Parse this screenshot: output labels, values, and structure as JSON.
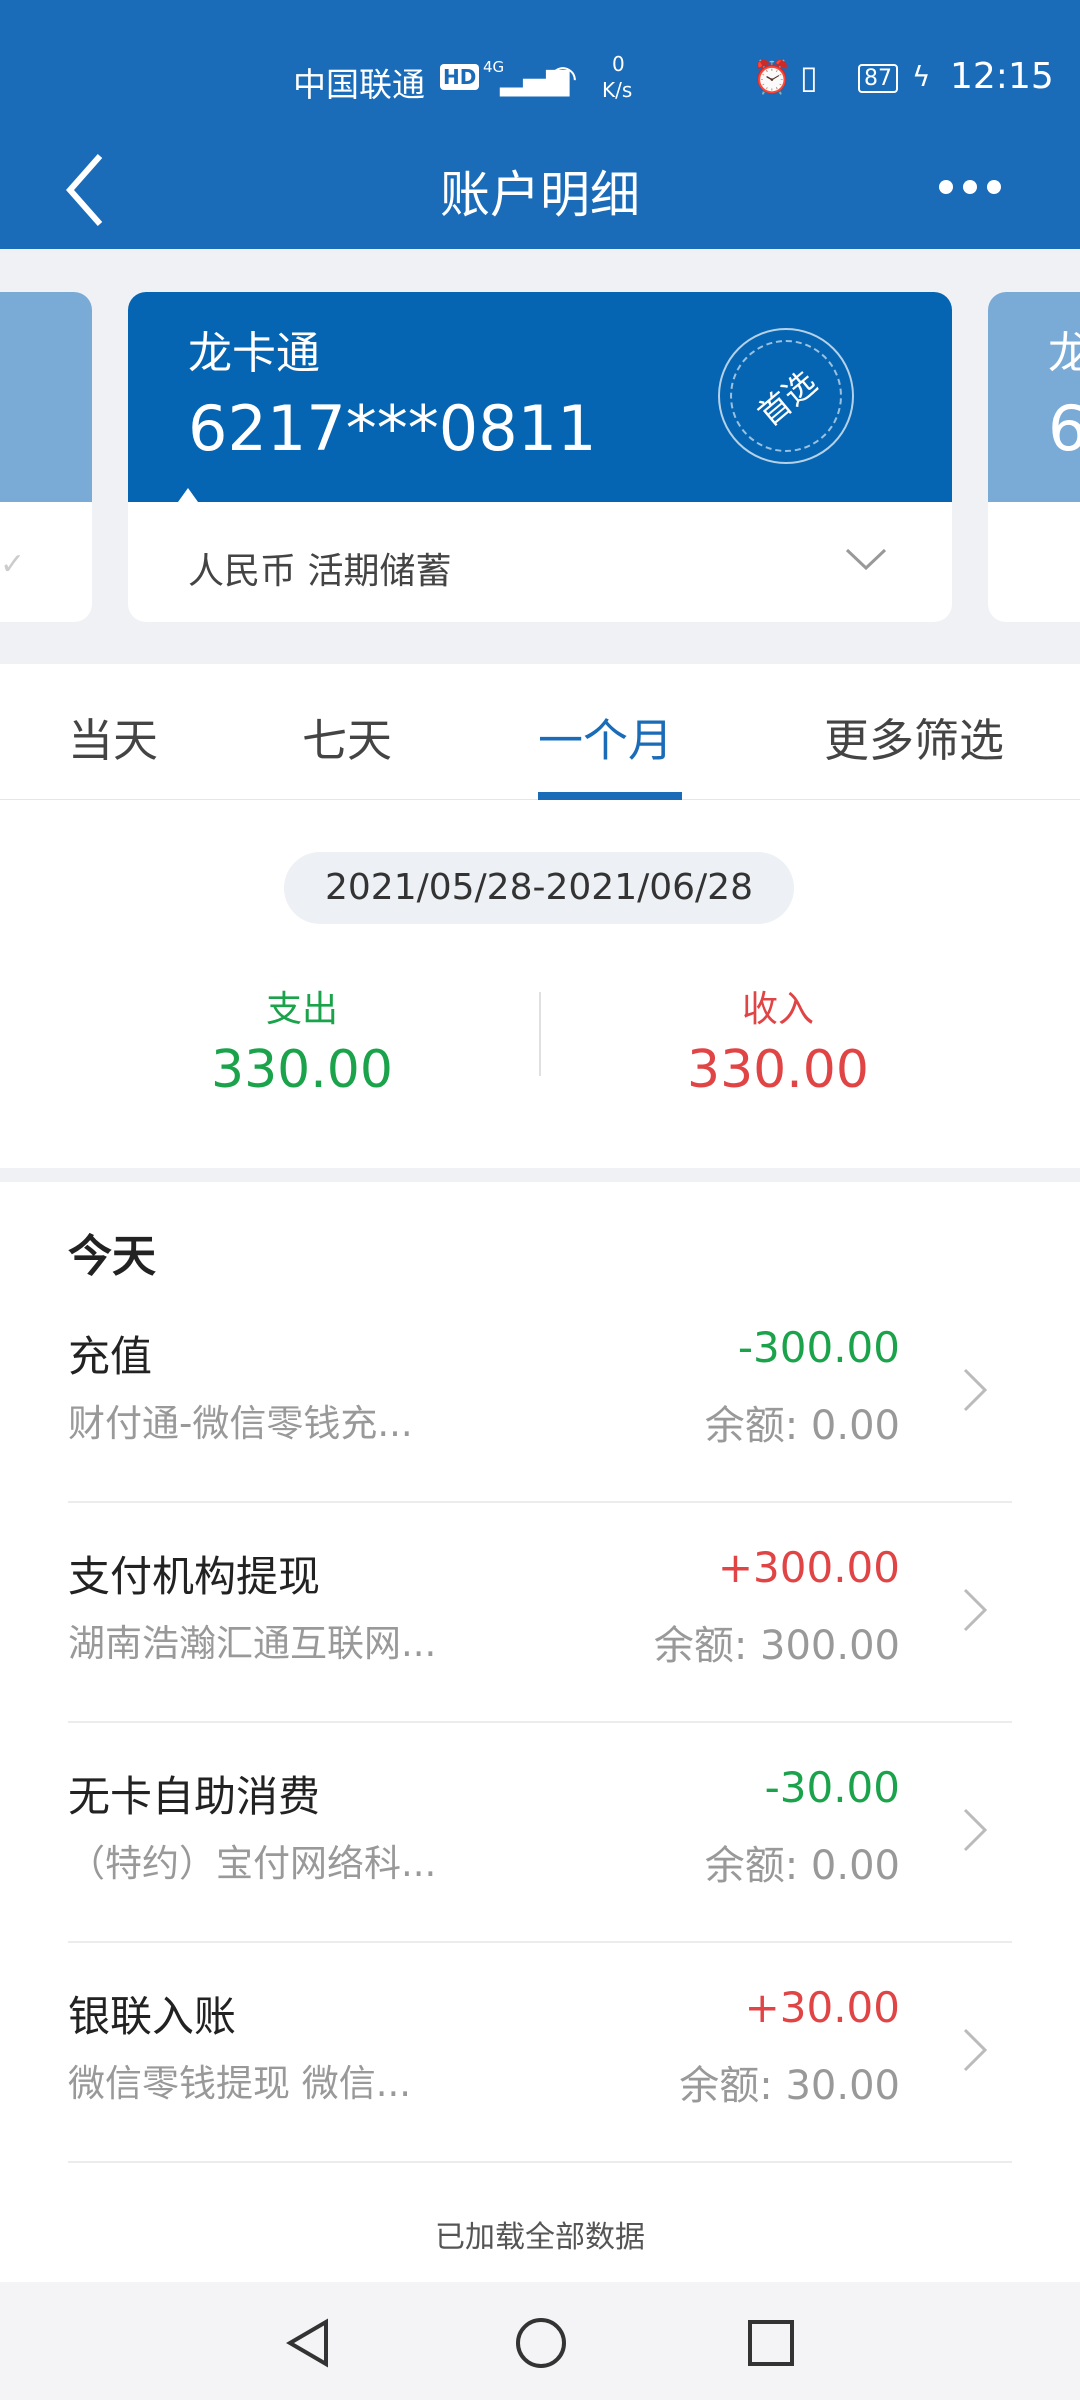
{
  "status_bar": {
    "carrier": "中国联通",
    "hd": "HD",
    "network": "4G",
    "speed_value": "0",
    "speed_unit": "K/s",
    "battery": "87",
    "time": "12:15"
  },
  "header": {
    "title": "账户明细",
    "back_icon": "chevron-left-icon",
    "more_icon": "more-dots-icon"
  },
  "card": {
    "name": "龙卡通",
    "number": "6217***0811",
    "badge": "首选",
    "account_type": "人民币 活期储蓄"
  },
  "side_cards": {
    "right_name": "龙",
    "right_number": "6"
  },
  "tabs": [
    {
      "label": "当天"
    },
    {
      "label": "七天"
    },
    {
      "label": "一个月",
      "active": true
    },
    {
      "label": "更多筛选"
    }
  ],
  "date_range": "2021/05/28-2021/06/28",
  "summary": {
    "expense_label": "支出",
    "expense_value": "330.00",
    "income_label": "收入",
    "income_value": "330.00"
  },
  "colors": {
    "primary": "#1a6bb8",
    "expense": "#1aa34a",
    "income": "#e04444"
  },
  "section_title": "今天",
  "transactions": [
    {
      "title": "充值",
      "desc": "财付通-微信零钱充...",
      "amount": "-300.00",
      "type": "expense",
      "balance": "余额: 0.00"
    },
    {
      "title": "支付机构提现",
      "desc": "湖南浩瀚汇通互联网...",
      "amount": "+300.00",
      "type": "income",
      "balance": "余额: 300.00"
    },
    {
      "title": "无卡自助消费",
      "desc": "（特约）宝付网络科...",
      "amount": "-30.00",
      "type": "expense",
      "balance": "余额: 0.00"
    },
    {
      "title": "银联入账",
      "desc": "微信零钱提现 微信...",
      "amount": "+30.00",
      "type": "income",
      "balance": "余额: 30.00"
    }
  ],
  "footer_text": "已加载全部数据"
}
